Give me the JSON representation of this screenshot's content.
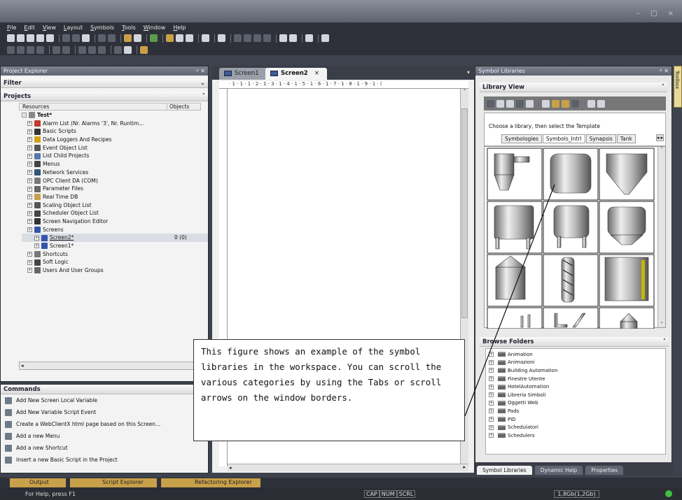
{
  "menu": [
    "File",
    "Edit",
    "View",
    "Layout",
    "Symbols",
    "Tools",
    "Window",
    "Help"
  ],
  "project_explorer": {
    "title": "Project Explorer",
    "filter_label": "Filter",
    "projects_label": "Projects",
    "col_resources": "Resources",
    "col_objects": "Objects",
    "root": "Test*",
    "items": [
      {
        "label": "Alarm List (Nr. Alarms '3', Nr. Runtim...",
        "color": "#c0392b"
      },
      {
        "label": "Basic Scripts",
        "color": "#333333"
      },
      {
        "label": "Data Loggers And Recipes",
        "color": "#d4a017"
      },
      {
        "label": "Event Object List",
        "color": "#555555"
      },
      {
        "label": "List Child Projects",
        "color": "#5577aa"
      },
      {
        "label": "Menus",
        "color": "#444444"
      },
      {
        "label": "Network Services",
        "color": "#335577"
      },
      {
        "label": "OPC Client DA (COM)",
        "color": "#777777"
      },
      {
        "label": "Parameter Files",
        "color": "#666666"
      },
      {
        "label": "Real Time DB",
        "color": "#c9a04a"
      },
      {
        "label": "Scaling Object List",
        "color": "#555555"
      },
      {
        "label": "Scheduler Object List",
        "color": "#444444"
      },
      {
        "label": "Screen Navigation Editor",
        "color": "#333333"
      },
      {
        "label": "Screens",
        "color": "#3355aa"
      }
    ],
    "screens": [
      {
        "label": "Screen2*",
        "objects": "0 (0)"
      },
      {
        "label": "Screen1*",
        "objects": ""
      }
    ],
    "items_after": [
      {
        "label": "Shortcuts",
        "color": "#777777"
      },
      {
        "label": "Soft Logic",
        "color": "#444444"
      },
      {
        "label": "Users And User Groups",
        "color": "#666666"
      }
    ]
  },
  "commands": {
    "title": "Commands",
    "items": [
      "Add New Screen Local Variable",
      "Add New Variable Script Event",
      "Create a WebClientX html page based on this Screen...",
      "Add a new Menu",
      "Add a new Shortcut",
      "Insert a new Basic Script in the Project"
    ]
  },
  "editor": {
    "tabs": [
      "Screen1",
      "Screen2"
    ],
    "active_tab": "Screen2",
    "ruler": "· 1 · 1 · 1 · 2 · 1 · 3 · 1 · 4 · 1 · 5 · 1 · 6 · 1 · 7 · 1 · 8 · 1 · 9 · 1 · ("
  },
  "symbol_libraries": {
    "title": "Symbol Libraries",
    "library_view": "Library View",
    "hint": "Choose a library, then select the Template",
    "tabs": [
      "Symbologies",
      "Symbols_Intrl",
      "Synapsis",
      "Tank"
    ],
    "browse_folders": "Browse Folders",
    "folders": [
      "Animation",
      "Animazioni",
      "Building Automation",
      "Finestre Utente",
      "HotelAutomation",
      "Libreria Simboli",
      "Oggetti Web",
      "Pads",
      "PID",
      "Schedulatori",
      "Schedulers"
    ],
    "bottom_tabs": [
      "Symbol Libraries",
      "Dynamic Help",
      "Properties"
    ]
  },
  "toolbox_label": "Toolbox",
  "callout": "This figure shows an example of the symbol libraries in the workspace.  You can scroll the various categories by using the Tabs or scroll arrows on the window borders.",
  "bottom_tabs": [
    "Output",
    "Script Explorer",
    "Refactoring Explorer"
  ],
  "status": {
    "help": "For Help, press F1",
    "cap": "CAP",
    "num": "NUM",
    "scrl": "SCRL",
    "memory": "1,8Gb(1,2Gb)"
  }
}
